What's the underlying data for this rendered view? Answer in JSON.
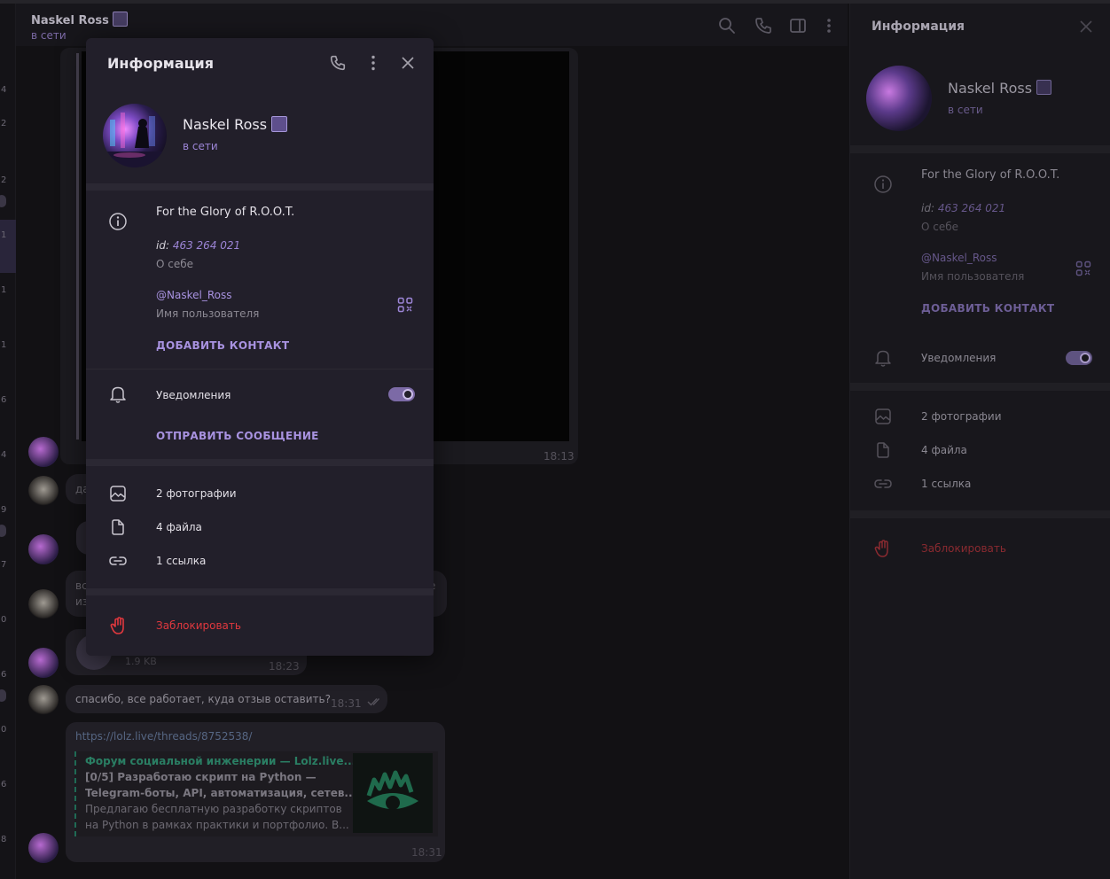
{
  "chat_header": {
    "title": "Naskel Ross",
    "status": "в сети"
  },
  "left_strip": {
    "labels": [
      "4",
      "2",
      "2",
      "2",
      "1",
      "1",
      "1",
      "6",
      "4",
      "9",
      "7",
      "0",
      "6",
      "2",
      "0",
      "6",
      "8"
    ]
  },
  "popup": {
    "title": "Информация",
    "name": "Naskel Ross",
    "status": "в сети",
    "bio": "For the Glory of R.O.O.T.",
    "id_label": "id:",
    "id_value": "463 264 021",
    "about_label": "О себе",
    "username": "@Naskel_Ross",
    "username_label": "Имя пользователя",
    "add_contact": "ДОБАВИТЬ КОНТАКТ",
    "notifications": "Уведомления",
    "notifications_on": true,
    "send_message": "ОТПРАВИТЬ СООБЩЕНИЕ",
    "photos": "2 фотографии",
    "files": "4 файла",
    "links": "1 ссылка",
    "block": "Заблокировать"
  },
  "right_panel": {
    "title": "Информация",
    "name": "Naskel Ross",
    "status": "в сети",
    "bio": "For the Glory of R.O.O.T.",
    "id_label": "id:",
    "id_value": "463 264 021",
    "about_label": "О себе",
    "username": "@Naskel_Ross",
    "username_label": "Имя пользователя",
    "add_contact": "ДОБАВИТЬ КОНТАКТ",
    "notifications": "Уведомления",
    "notifications_on": true,
    "photos": "2 фотографии",
    "files": "4 файла",
    "links": "1 ссылка",
    "block": "Заблокировать"
  },
  "messages": {
    "media_time": "18:13",
    "partial_1": "да",
    "partial_2a": "вс",
    "partial_2b": "из",
    "partial_2c": "е",
    "file_size": "1.9 KB",
    "file_time": "18:23",
    "thanks_text": "спасибо, все работает, куда отзыв оставить?",
    "thanks_time": "18:31",
    "link_url": "https://lolz.live/threads/8752538/",
    "preview_site": "Форум социальной инженерии — Lolz.live...",
    "preview_title_1": "[0/5] Разработаю скрипт на Python —",
    "preview_title_2": "Telegram-боты, API, автоматизация, сетев...",
    "preview_desc_1": "Предлагаю бесплатную разработку скриптов",
    "preview_desc_2": "на Python в рамках практики и портфолио. В...",
    "link_time": "18:31"
  },
  "colors": {
    "accent": "#9c85d6",
    "danger": "#e0383e",
    "link_preview": "#2f9e7a",
    "popup_bg": "#221f2a"
  }
}
